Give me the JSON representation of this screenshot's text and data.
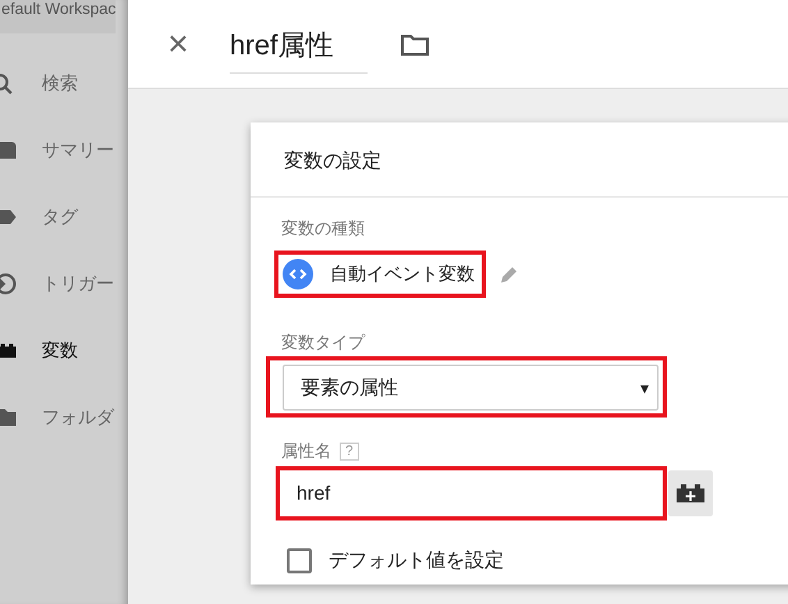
{
  "workspace": {
    "title": "efault Workspac"
  },
  "sidebar": {
    "items": [
      {
        "label": "検索",
        "kind": "search",
        "selected": false
      },
      {
        "label": "サマリー",
        "kind": "summary",
        "selected": false
      },
      {
        "label": "タグ",
        "kind": "tag",
        "selected": false
      },
      {
        "label": "トリガー",
        "kind": "trigger",
        "selected": false
      },
      {
        "label": "変数",
        "kind": "variable",
        "selected": true
      },
      {
        "label": "フォルダ",
        "kind": "folder",
        "selected": false
      }
    ]
  },
  "editor": {
    "close": "×",
    "name": "href属性"
  },
  "card": {
    "title": "変数の設定",
    "variable_kind": {
      "label": "変数の種類",
      "value": "自動イベント変数"
    },
    "variable_type": {
      "label": "変数タイプ",
      "value": "要素の属性",
      "arrow": "▾"
    },
    "attribute_name": {
      "label": "属性名",
      "help": "?",
      "value": "href"
    },
    "default_value": {
      "label": "デフォルト値を設定",
      "checked": false
    }
  }
}
